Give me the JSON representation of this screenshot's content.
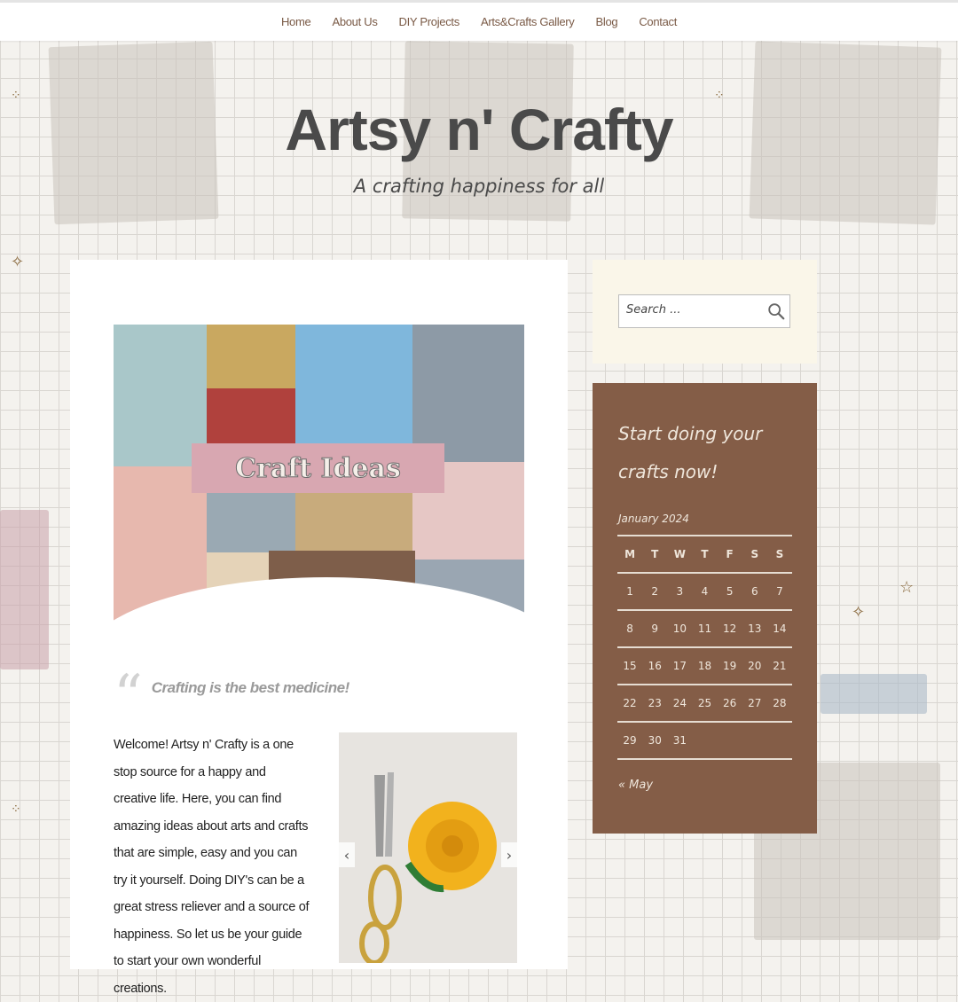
{
  "nav": {
    "items": [
      "Home",
      "About Us",
      "DIY Projects",
      "Arts&Crafts Gallery",
      "Blog",
      "Contact"
    ]
  },
  "header": {
    "title": "Artsy n' Crafty",
    "tagline": "A crafting happiness for all"
  },
  "main": {
    "banner_label": "Craft Ideas",
    "quote": "Crafting is the best medicine!",
    "welcome": "Welcome! Artsy n' Crafty is a one stop source for a happy and creative life. Here, you can find amazing ideas about arts and crafts that are simple, easy and you can try it yourself. Doing DIY's can be a great stress reliever and a source of happiness. So let us be your guide to start your own wonderful creations."
  },
  "search": {
    "placeholder": "Search ..."
  },
  "calendar": {
    "heading": "Start doing your crafts now!",
    "caption": "January 2024",
    "weekdays": [
      "M",
      "T",
      "W",
      "T",
      "F",
      "S",
      "S"
    ],
    "weeks": [
      [
        "1",
        "2",
        "3",
        "4",
        "5",
        "6",
        "7"
      ],
      [
        "8",
        "9",
        "10",
        "11",
        "12",
        "13",
        "14"
      ],
      [
        "15",
        "16",
        "17",
        "18",
        "19",
        "20",
        "21"
      ],
      [
        "22",
        "23",
        "24",
        "25",
        "26",
        "27",
        "28"
      ],
      [
        "29",
        "30",
        "31",
        "",
        "",
        "",
        ""
      ]
    ],
    "prev_link": "« May"
  },
  "colors": {
    "nav_text": "#7a5a46",
    "calendar_bg": "#845d47",
    "search_widget_bg": "#faf6e9",
    "banner_label_bg": "#d8a7b1"
  }
}
